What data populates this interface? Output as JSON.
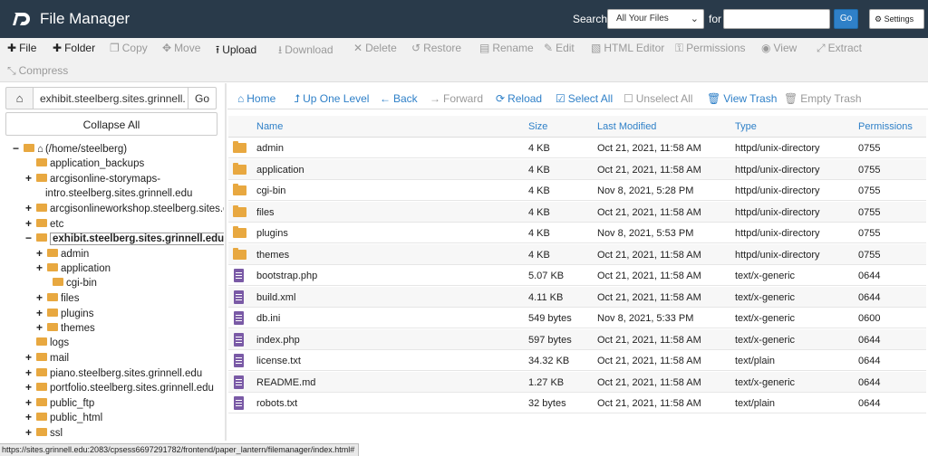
{
  "header": {
    "app_title": "File Manager",
    "search_label": "Search",
    "scope_value": "All Your Files",
    "for_label": "for",
    "search_placeholder": "",
    "go_label": "Go",
    "settings_label": "Settings",
    "logo_icon": "cpanel-logo",
    "colors": {
      "header_bg": "#293a4a",
      "accent": "#2f80c8",
      "folder": "#e8a840",
      "file": "#7a5aa6"
    }
  },
  "toolbar": {
    "file": "File",
    "folder": "Folder",
    "copy": "Copy",
    "move": "Move",
    "upload": "Upload",
    "download": "Download",
    "delete": "Delete",
    "restore": "Restore",
    "rename": "Rename",
    "edit": "Edit",
    "html_editor": "HTML Editor",
    "permissions": "Permissions",
    "view": "View",
    "extract": "Extract",
    "compress": "Compress"
  },
  "path_bar": {
    "value": "exhibit.steelberg.sites.grinnell.",
    "go_label": "Go",
    "collapse_label": "Collapse All"
  },
  "tree": [
    {
      "toggle": "−",
      "label": "(/home/steelberg)",
      "home": true
    },
    {
      "toggle": "",
      "label": "application_backups"
    },
    {
      "toggle": "+",
      "label": "arcgisonline-storymaps-"
    },
    {
      "toggle": "",
      "label": "intro.steelberg.sites.grinnell.edu"
    },
    {
      "toggle": "+",
      "label": "arcgisonlineworkshop.steelberg.sites.gri"
    },
    {
      "toggle": "+",
      "label": "etc"
    },
    {
      "toggle": "−",
      "label": "exhibit.steelberg.sites.grinnell.edu",
      "selected": true
    },
    {
      "toggle": "+",
      "label": "admin"
    },
    {
      "toggle": "+",
      "label": "application"
    },
    {
      "toggle": "",
      "label": "cgi-bin"
    },
    {
      "toggle": "+",
      "label": "files"
    },
    {
      "toggle": "+",
      "label": "plugins"
    },
    {
      "toggle": "+",
      "label": "themes"
    },
    {
      "toggle": "",
      "label": "logs"
    },
    {
      "toggle": "+",
      "label": "mail"
    },
    {
      "toggle": "+",
      "label": "piano.steelberg.sites.grinnell.edu"
    },
    {
      "toggle": "+",
      "label": "portfolio.steelberg.sites.grinnell.edu"
    },
    {
      "toggle": "+",
      "label": "public_ftp"
    },
    {
      "toggle": "+",
      "label": "public_html"
    },
    {
      "toggle": "+",
      "label": "ssl"
    }
  ],
  "nav": {
    "home": "Home",
    "up_one_level": "Up One Level",
    "back": "Back",
    "forward": "Forward",
    "reload": "Reload",
    "select_all": "Select All",
    "unselect_all": "Unselect All",
    "view_trash": "View Trash",
    "empty_trash": "Empty Trash"
  },
  "table": {
    "columns": [
      "Name",
      "Size",
      "Last Modified",
      "Type",
      "Permissions"
    ],
    "rows": [
      {
        "icon": "folder-icon",
        "name": "admin",
        "size": "4 KB",
        "modified": "Oct 21, 2021, 11:58 AM",
        "type": "httpd/unix-directory",
        "perms": "0755"
      },
      {
        "icon": "folder-icon",
        "name": "application",
        "size": "4 KB",
        "modified": "Oct 21, 2021, 11:58 AM",
        "type": "httpd/unix-directory",
        "perms": "0755"
      },
      {
        "icon": "folder-icon",
        "name": "cgi-bin",
        "size": "4 KB",
        "modified": "Nov 8, 2021, 5:28 PM",
        "type": "httpd/unix-directory",
        "perms": "0755"
      },
      {
        "icon": "folder-icon",
        "name": "files",
        "size": "4 KB",
        "modified": "Oct 21, 2021, 11:58 AM",
        "type": "httpd/unix-directory",
        "perms": "0755"
      },
      {
        "icon": "folder-icon",
        "name": "plugins",
        "size": "4 KB",
        "modified": "Nov 8, 2021, 5:53 PM",
        "type": "httpd/unix-directory",
        "perms": "0755"
      },
      {
        "icon": "folder-icon",
        "name": "themes",
        "size": "4 KB",
        "modified": "Oct 21, 2021, 11:58 AM",
        "type": "httpd/unix-directory",
        "perms": "0755"
      },
      {
        "icon": "file-icon",
        "name": "bootstrap.php",
        "size": "5.07 KB",
        "modified": "Oct 21, 2021, 11:58 AM",
        "type": "text/x-generic",
        "perms": "0644"
      },
      {
        "icon": "file-icon",
        "name": "build.xml",
        "size": "4.11 KB",
        "modified": "Oct 21, 2021, 11:58 AM",
        "type": "text/x-generic",
        "perms": "0644"
      },
      {
        "icon": "file-icon",
        "name": "db.ini",
        "size": "549 bytes",
        "modified": "Nov 8, 2021, 5:33 PM",
        "type": "text/x-generic",
        "perms": "0600"
      },
      {
        "icon": "file-icon",
        "name": "index.php",
        "size": "597 bytes",
        "modified": "Oct 21, 2021, 11:58 AM",
        "type": "text/x-generic",
        "perms": "0644"
      },
      {
        "icon": "file-icon",
        "name": "license.txt",
        "size": "34.32 KB",
        "modified": "Oct 21, 2021, 11:58 AM",
        "type": "text/plain",
        "perms": "0644"
      },
      {
        "icon": "file-icon",
        "name": "README.md",
        "size": "1.27 KB",
        "modified": "Oct 21, 2021, 11:58 AM",
        "type": "text/x-generic",
        "perms": "0644"
      },
      {
        "icon": "file-icon",
        "name": "robots.txt",
        "size": "32 bytes",
        "modified": "Oct 21, 2021, 11:58 AM",
        "type": "text/plain",
        "perms": "0644"
      }
    ]
  },
  "status_url": "https://sites.grinnell.edu:2083/cpsess6697291782/frontend/paper_lantern/filemanager/index.html#"
}
